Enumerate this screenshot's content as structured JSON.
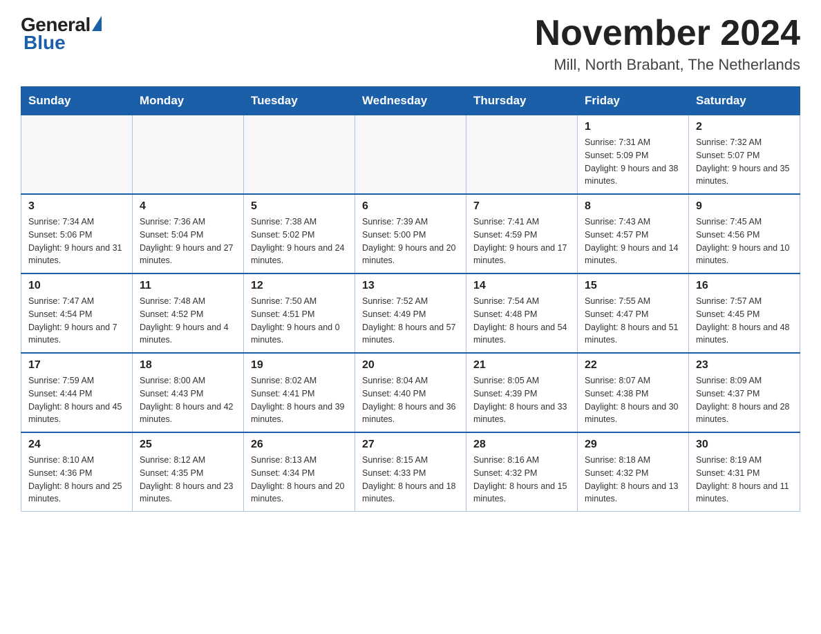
{
  "header": {
    "logo_general": "General",
    "logo_blue": "Blue",
    "month_title": "November 2024",
    "location": "Mill, North Brabant, The Netherlands"
  },
  "days_of_week": [
    "Sunday",
    "Monday",
    "Tuesday",
    "Wednesday",
    "Thursday",
    "Friday",
    "Saturday"
  ],
  "weeks": [
    [
      {
        "day": "",
        "info": ""
      },
      {
        "day": "",
        "info": ""
      },
      {
        "day": "",
        "info": ""
      },
      {
        "day": "",
        "info": ""
      },
      {
        "day": "",
        "info": ""
      },
      {
        "day": "1",
        "info": "Sunrise: 7:31 AM\nSunset: 5:09 PM\nDaylight: 9 hours and 38 minutes."
      },
      {
        "day": "2",
        "info": "Sunrise: 7:32 AM\nSunset: 5:07 PM\nDaylight: 9 hours and 35 minutes."
      }
    ],
    [
      {
        "day": "3",
        "info": "Sunrise: 7:34 AM\nSunset: 5:06 PM\nDaylight: 9 hours and 31 minutes."
      },
      {
        "day": "4",
        "info": "Sunrise: 7:36 AM\nSunset: 5:04 PM\nDaylight: 9 hours and 27 minutes."
      },
      {
        "day": "5",
        "info": "Sunrise: 7:38 AM\nSunset: 5:02 PM\nDaylight: 9 hours and 24 minutes."
      },
      {
        "day": "6",
        "info": "Sunrise: 7:39 AM\nSunset: 5:00 PM\nDaylight: 9 hours and 20 minutes."
      },
      {
        "day": "7",
        "info": "Sunrise: 7:41 AM\nSunset: 4:59 PM\nDaylight: 9 hours and 17 minutes."
      },
      {
        "day": "8",
        "info": "Sunrise: 7:43 AM\nSunset: 4:57 PM\nDaylight: 9 hours and 14 minutes."
      },
      {
        "day": "9",
        "info": "Sunrise: 7:45 AM\nSunset: 4:56 PM\nDaylight: 9 hours and 10 minutes."
      }
    ],
    [
      {
        "day": "10",
        "info": "Sunrise: 7:47 AM\nSunset: 4:54 PM\nDaylight: 9 hours and 7 minutes."
      },
      {
        "day": "11",
        "info": "Sunrise: 7:48 AM\nSunset: 4:52 PM\nDaylight: 9 hours and 4 minutes."
      },
      {
        "day": "12",
        "info": "Sunrise: 7:50 AM\nSunset: 4:51 PM\nDaylight: 9 hours and 0 minutes."
      },
      {
        "day": "13",
        "info": "Sunrise: 7:52 AM\nSunset: 4:49 PM\nDaylight: 8 hours and 57 minutes."
      },
      {
        "day": "14",
        "info": "Sunrise: 7:54 AM\nSunset: 4:48 PM\nDaylight: 8 hours and 54 minutes."
      },
      {
        "day": "15",
        "info": "Sunrise: 7:55 AM\nSunset: 4:47 PM\nDaylight: 8 hours and 51 minutes."
      },
      {
        "day": "16",
        "info": "Sunrise: 7:57 AM\nSunset: 4:45 PM\nDaylight: 8 hours and 48 minutes."
      }
    ],
    [
      {
        "day": "17",
        "info": "Sunrise: 7:59 AM\nSunset: 4:44 PM\nDaylight: 8 hours and 45 minutes."
      },
      {
        "day": "18",
        "info": "Sunrise: 8:00 AM\nSunset: 4:43 PM\nDaylight: 8 hours and 42 minutes."
      },
      {
        "day": "19",
        "info": "Sunrise: 8:02 AM\nSunset: 4:41 PM\nDaylight: 8 hours and 39 minutes."
      },
      {
        "day": "20",
        "info": "Sunrise: 8:04 AM\nSunset: 4:40 PM\nDaylight: 8 hours and 36 minutes."
      },
      {
        "day": "21",
        "info": "Sunrise: 8:05 AM\nSunset: 4:39 PM\nDaylight: 8 hours and 33 minutes."
      },
      {
        "day": "22",
        "info": "Sunrise: 8:07 AM\nSunset: 4:38 PM\nDaylight: 8 hours and 30 minutes."
      },
      {
        "day": "23",
        "info": "Sunrise: 8:09 AM\nSunset: 4:37 PM\nDaylight: 8 hours and 28 minutes."
      }
    ],
    [
      {
        "day": "24",
        "info": "Sunrise: 8:10 AM\nSunset: 4:36 PM\nDaylight: 8 hours and 25 minutes."
      },
      {
        "day": "25",
        "info": "Sunrise: 8:12 AM\nSunset: 4:35 PM\nDaylight: 8 hours and 23 minutes."
      },
      {
        "day": "26",
        "info": "Sunrise: 8:13 AM\nSunset: 4:34 PM\nDaylight: 8 hours and 20 minutes."
      },
      {
        "day": "27",
        "info": "Sunrise: 8:15 AM\nSunset: 4:33 PM\nDaylight: 8 hours and 18 minutes."
      },
      {
        "day": "28",
        "info": "Sunrise: 8:16 AM\nSunset: 4:32 PM\nDaylight: 8 hours and 15 minutes."
      },
      {
        "day": "29",
        "info": "Sunrise: 8:18 AM\nSunset: 4:32 PM\nDaylight: 8 hours and 13 minutes."
      },
      {
        "day": "30",
        "info": "Sunrise: 8:19 AM\nSunset: 4:31 PM\nDaylight: 8 hours and 11 minutes."
      }
    ]
  ]
}
